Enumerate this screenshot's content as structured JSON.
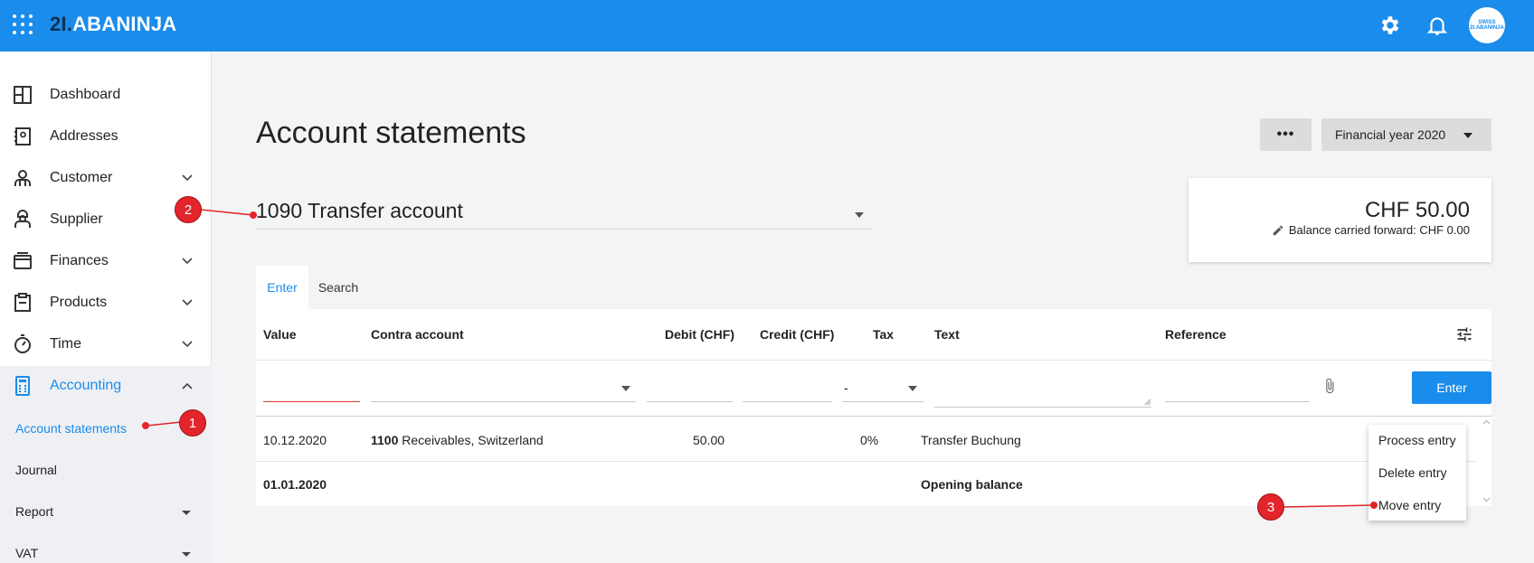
{
  "header": {
    "logo_prefix": "2I.",
    "logo_text": "ABANINJA",
    "avatar_text": "SWISS 2I.ABANINJA"
  },
  "sidebar": {
    "items": [
      {
        "label": "Dashboard"
      },
      {
        "label": "Addresses"
      },
      {
        "label": "Customer"
      },
      {
        "label": "Supplier"
      },
      {
        "label": "Finances"
      },
      {
        "label": "Products"
      },
      {
        "label": "Time"
      },
      {
        "label": "Accounting"
      }
    ],
    "sub_items": [
      {
        "label": "Account statements"
      },
      {
        "label": "Journal"
      },
      {
        "label": "Report"
      },
      {
        "label": "VAT"
      }
    ]
  },
  "main": {
    "title": "Account statements",
    "more_label": "•••",
    "financial_year": "Financial year 2020",
    "account": "1090 Transfer account",
    "balance": {
      "amount": "CHF 50.00",
      "carried_forward": "Balance carried forward: CHF 0.00"
    },
    "tabs": [
      {
        "label": "Enter"
      },
      {
        "label": "Search"
      }
    ],
    "columns": [
      "Value",
      "Contra account",
      "Debit (CHF)",
      "Credit (CHF)",
      "Tax",
      "Text",
      "Reference"
    ],
    "tax_select_value": "-",
    "enter_button": "Enter",
    "rows": [
      {
        "value": "10.12.2020",
        "contra_number": "1100",
        "contra_name": "Receivables, Switzerland",
        "debit": "50.00",
        "tax": "0%",
        "text": "Transfer Buchung"
      },
      {
        "value": "01.01.2020",
        "text": "Opening balance"
      }
    ],
    "context_menu": [
      "Process entry",
      "Delete entry",
      "Move entry"
    ]
  },
  "annotations": [
    "1",
    "2",
    "3"
  ],
  "colors": {
    "accent": "#1a8cec",
    "annotation": "#e3242b"
  }
}
